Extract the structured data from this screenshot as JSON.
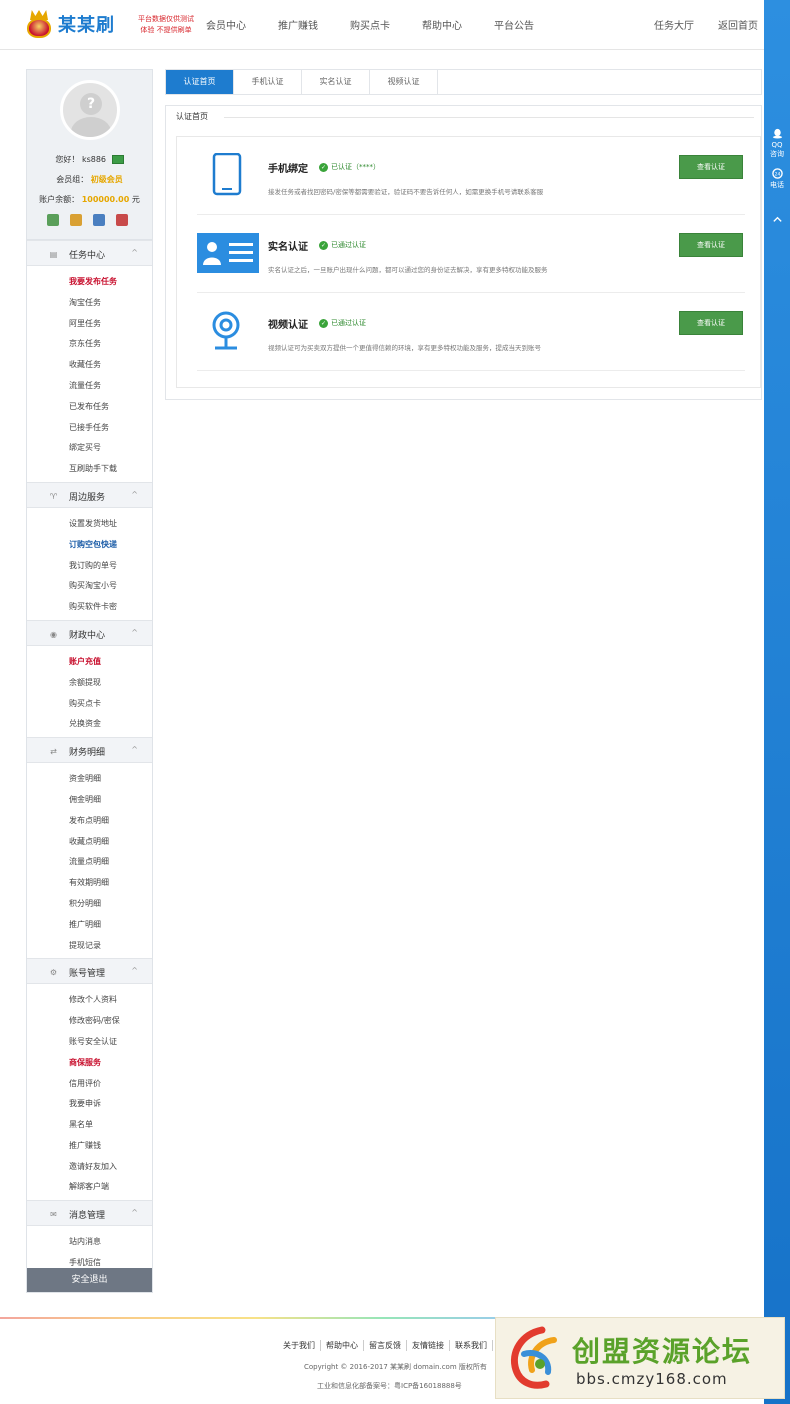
{
  "header": {
    "logo_text": "某某刷",
    "slogan_line1": "平台数据仅供测试",
    "slogan_line2": "体验  不提供刷单",
    "nav": [
      "会员中心",
      "推广赚钱",
      "购买点卡",
      "帮助中心",
      "平台公告"
    ],
    "nav_right": [
      "任务大厅",
      "返回首页"
    ]
  },
  "rightbar": {
    "qq_label1": "QQ",
    "qq_label2": "咨询",
    "phone_badge": "24",
    "phone_label": "电话"
  },
  "profile": {
    "greeting": "您好！",
    "username": "ks886",
    "level_label": "会员组：",
    "level_value": "初级会员",
    "balance_label": "账户余额：",
    "balance_value": "100000.00",
    "balance_unit": "元"
  },
  "sidebar": {
    "sections": [
      {
        "title": "任务中心",
        "icon": "doc-icon",
        "items": [
          {
            "label": "我要发布任务",
            "style": "hot"
          },
          {
            "label": "淘宝任务",
            "style": ""
          },
          {
            "label": "阿里任务",
            "style": ""
          },
          {
            "label": "京东任务",
            "style": ""
          },
          {
            "label": "收藏任务",
            "style": ""
          },
          {
            "label": "流量任务",
            "style": ""
          },
          {
            "label": "已发布任务",
            "style": ""
          },
          {
            "label": "已接手任务",
            "style": ""
          },
          {
            "label": "绑定买号",
            "style": ""
          },
          {
            "label": "互刷助手下载",
            "style": ""
          }
        ]
      },
      {
        "title": "周边服务",
        "icon": "shirt-icon",
        "items": [
          {
            "label": "设置发货地址",
            "style": ""
          },
          {
            "label": "订购空包快递",
            "style": "link"
          },
          {
            "label": "我订购的单号",
            "style": ""
          },
          {
            "label": "购买淘宝小号",
            "style": ""
          },
          {
            "label": "购买软件卡密",
            "style": ""
          }
        ]
      },
      {
        "title": "财政中心",
        "icon": "coin-icon",
        "items": [
          {
            "label": "账户充值",
            "style": "hot"
          },
          {
            "label": "余额提现",
            "style": ""
          },
          {
            "label": "购买点卡",
            "style": ""
          },
          {
            "label": "兑换资金",
            "style": ""
          }
        ]
      },
      {
        "title": "财务明细",
        "icon": "exchange-icon",
        "items": [
          {
            "label": "资金明细",
            "style": ""
          },
          {
            "label": "佣金明细",
            "style": ""
          },
          {
            "label": "发布点明细",
            "style": ""
          },
          {
            "label": "收藏点明细",
            "style": ""
          },
          {
            "label": "流量点明细",
            "style": ""
          },
          {
            "label": "有效期明细",
            "style": ""
          },
          {
            "label": "积分明细",
            "style": ""
          },
          {
            "label": "推广明细",
            "style": ""
          },
          {
            "label": "提现记录",
            "style": ""
          }
        ]
      },
      {
        "title": "账号管理",
        "icon": "gear-icon",
        "items": [
          {
            "label": "修改个人资料",
            "style": ""
          },
          {
            "label": "修改密码/密保",
            "style": ""
          },
          {
            "label": "账号安全认证",
            "style": ""
          },
          {
            "label": "商保服务",
            "style": "hot"
          },
          {
            "label": "信用评价",
            "style": ""
          },
          {
            "label": "我要申诉",
            "style": ""
          },
          {
            "label": "黑名单",
            "style": ""
          },
          {
            "label": "推广赚钱",
            "style": ""
          },
          {
            "label": "邀请好友加入",
            "style": ""
          },
          {
            "label": "解绑客户端",
            "style": ""
          }
        ]
      },
      {
        "title": "消息管理",
        "icon": "message-icon",
        "items": [
          {
            "label": "站内消息",
            "style": ""
          },
          {
            "label": "手机短信",
            "style": ""
          }
        ]
      }
    ],
    "logout": "安全退出"
  },
  "main": {
    "tabs": [
      "认证首页",
      "手机认证",
      "实名认证",
      "视频认证"
    ],
    "panel_title": "认证首页",
    "rows": [
      {
        "name": "手机绑定",
        "status": "已认证（****）",
        "desc": "接发任务或者找回密码/密保等都需要验证，验证码不要告诉任何人，如需更换手机号请联系客服",
        "button": "查看认证",
        "icon": "phone-icon"
      },
      {
        "name": "实名认证",
        "status": "已通过认证",
        "desc": "实名认证之后，一旦账户出现什么问题，都可以通过您的身份证去解决，享有更多特权功能及服务",
        "button": "查看认证",
        "icon": "id-card-icon"
      },
      {
        "name": "视频认证",
        "status": "已通过认证",
        "desc": "视频认证可为买卖双方提供一个更值得信赖的环境，享有更多特权功能及服务，提成当天到账号",
        "button": "查看认证",
        "icon": "webcam-icon"
      }
    ]
  },
  "footer": {
    "links": [
      "关于我们",
      "帮助中心",
      "留言反馈",
      "友情链接",
      "联系我们"
    ],
    "copyright": "Copyright © 2016-2017 某某刷  domain.com 版权所有",
    "icp": "工业和信息化部备案号：粤ICP备16018888号"
  },
  "watermark": {
    "title": "创盟资源论坛",
    "url": "bbs.cmzy168.com"
  },
  "colors": {
    "accent": "#1e7ccf",
    "button_green": "#4a9a4a",
    "hot_red": "#c8102e",
    "gold": "#e6a700"
  }
}
